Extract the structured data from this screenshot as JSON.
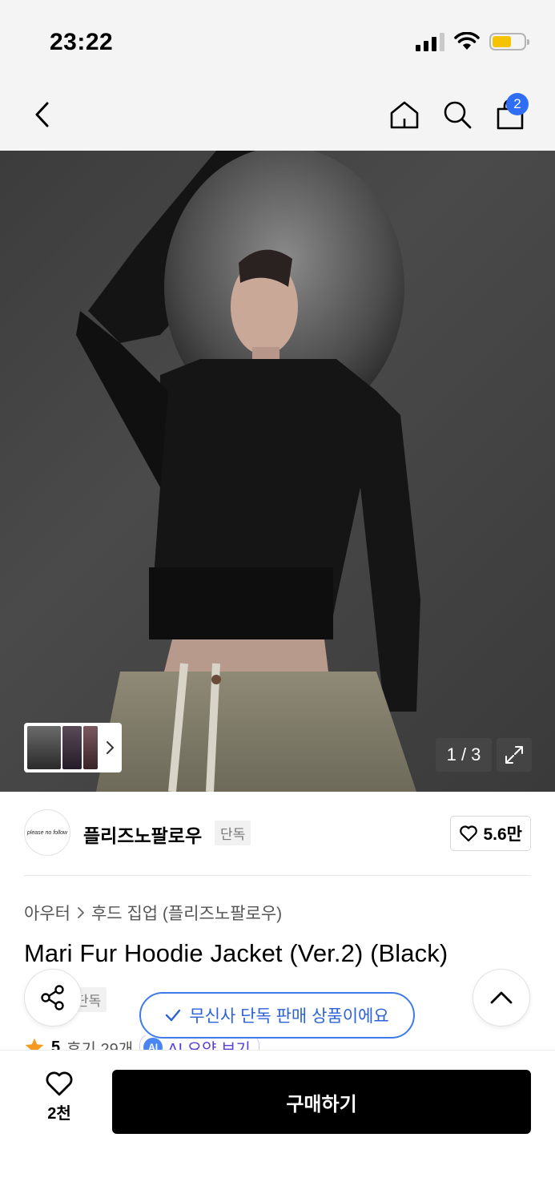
{
  "status_bar": {
    "time": "23:22",
    "icons": [
      "signal-icon",
      "wifi-icon",
      "battery-icon"
    ],
    "battery_color": "#f5c400"
  },
  "nav": {
    "back_icon": "chevron-left-icon",
    "home_icon": "home-icon",
    "search_icon": "search-icon",
    "cart_icon": "shopping-bag-icon",
    "cart_badge": "2",
    "badge_color": "#2f6df5"
  },
  "gallery": {
    "page_indicator": "1 / 3",
    "expand_icon": "expand-icon",
    "thumbnail_next_icon": "chevron-right-icon"
  },
  "brand": {
    "logo_text": "please no follow",
    "name": "플리즈노팔로우",
    "exclusive_tag": "단독",
    "like_count": "5.6만",
    "like_icon": "heart-outline-icon"
  },
  "product": {
    "breadcrumb": [
      "아우터",
      "후드 집업 (플리즈노팔로우)"
    ],
    "title": "Mari Fur Hoodie Jacket (Ver.2) (Black)",
    "sub_tag": "단독",
    "rating": "5",
    "review_text": "후기 29개",
    "ai_badge": "AI",
    "ai_summary": "AI 요약 보기",
    "star_color": "#f39a1f"
  },
  "floating": {
    "share_icon": "share-icon",
    "scroll_top_icon": "chevron-up-icon",
    "exclusive_notice": "무신사 단독 판매 상품이에요",
    "notice_color": "#2c62d8"
  },
  "bottom_bar": {
    "wish_count": "2천",
    "buy_label": "구매하기"
  }
}
